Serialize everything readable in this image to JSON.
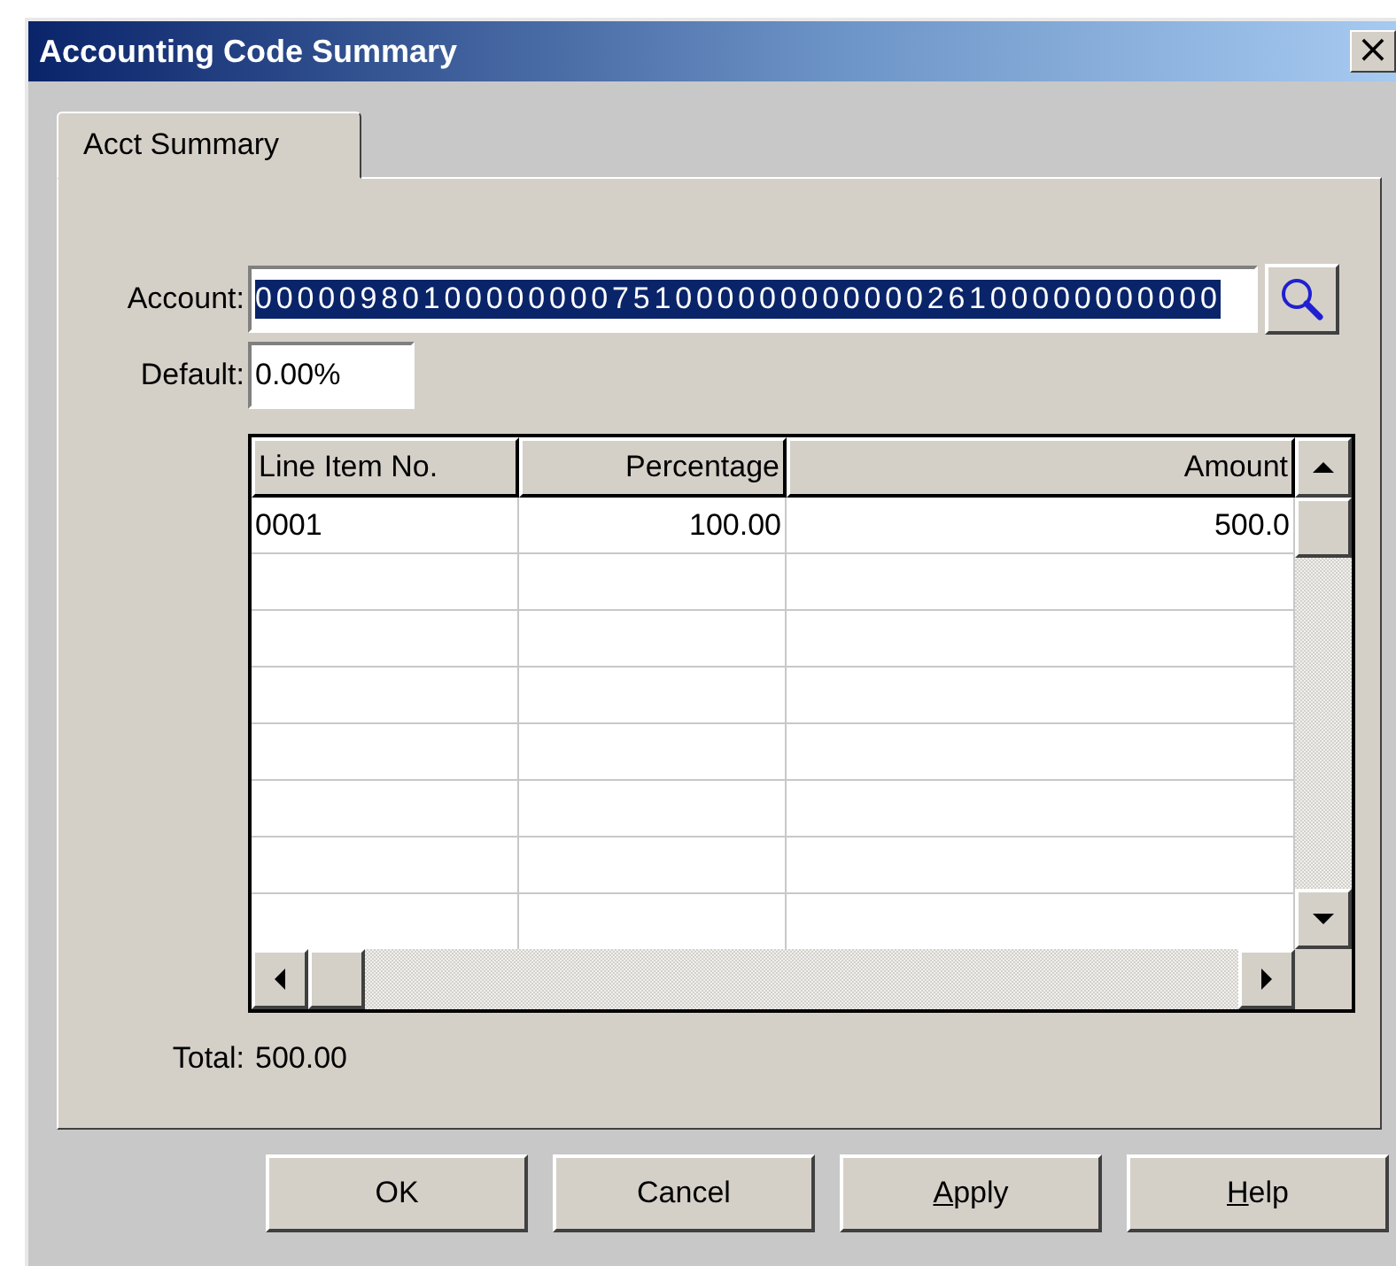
{
  "window": {
    "title": "Accounting Code Summary",
    "close": "×"
  },
  "tabs": [
    {
      "label": "Acct Summary",
      "selected": true
    }
  ],
  "account": {
    "label": "Account:",
    "value": "0000098010000000075100000000000026100000000000",
    "selected": true
  },
  "default": {
    "label": "Default:",
    "value": "0.00%"
  },
  "table": {
    "columns": [
      {
        "label": "Line Item No."
      },
      {
        "label": "Percentage"
      },
      {
        "label": "Amount"
      }
    ],
    "rows": [
      [
        "0001",
        "100.00",
        "500.0"
      ]
    ]
  },
  "total": {
    "label": "Total:",
    "value": "500.00"
  },
  "buttons": [
    {
      "label": "OK"
    },
    {
      "label": "Cancel"
    },
    {
      "mnemonic": "A",
      "label": "pply"
    },
    {
      "mnemonic": "H",
      "label": "elp"
    }
  ]
}
